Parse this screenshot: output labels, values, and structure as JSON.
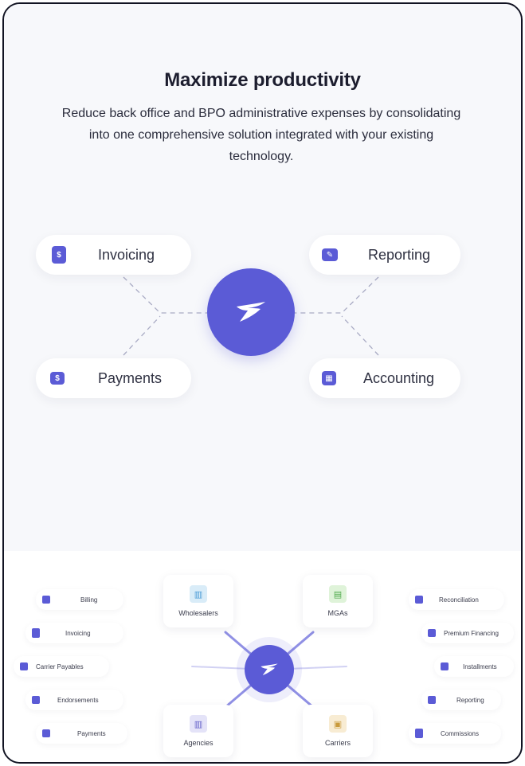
{
  "hero": {
    "title": "Maximize productivity",
    "subtitle_lines": [
      "Reduce back office and BPO administrative expenses by consolidating",
      "into one comprehensive solution integrated with your existing",
      "technology."
    ],
    "features": [
      {
        "label": "Invoicing",
        "icon": "invoice-icon",
        "glyph": "$"
      },
      {
        "label": "Reporting",
        "icon": "report-edit-icon",
        "glyph": "✎"
      },
      {
        "label": "Payments",
        "icon": "payment-icon",
        "glyph": "$"
      },
      {
        "label": "Accounting",
        "icon": "calculator-icon",
        "glyph": "▦"
      }
    ]
  },
  "ecosystem": {
    "parties": [
      {
        "label": "Wholesalers",
        "icon": "building-icon",
        "glyph": "▥",
        "color": "#d9ecf8"
      },
      {
        "label": "MGAs",
        "icon": "office-icon",
        "glyph": "▤",
        "color": "#dff3d9"
      },
      {
        "label": "Agencies",
        "icon": "company-icon",
        "glyph": "▥",
        "color": "#e4e3f8"
      },
      {
        "label": "Carriers",
        "icon": "bank-icon",
        "glyph": "▣",
        "color": "#f8ecd3"
      }
    ],
    "left_features": [
      "Billing",
      "Invoicing",
      "Carrier Payables",
      "Endorsements",
      "Payments"
    ],
    "right_features": [
      "Reconciliation",
      "Premium Financing",
      "Installments",
      "Reporting",
      "Commissions"
    ]
  },
  "colors": {
    "accent": "#5b5bd6",
    "background": "#f7f8fb"
  }
}
